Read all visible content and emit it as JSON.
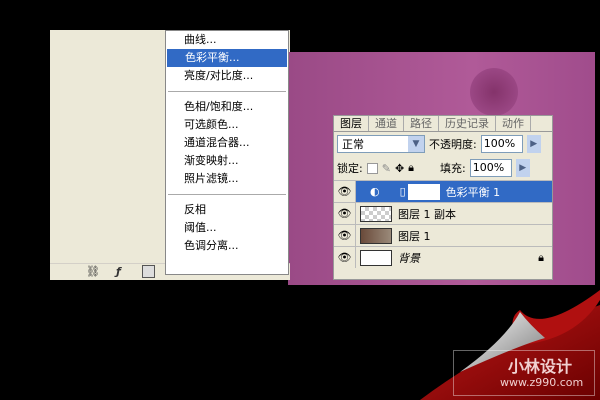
{
  "menu": {
    "items": [
      "曲线...",
      "色彩平衡...",
      "亮度/对比度...",
      "色相/饱和度...",
      "可选颜色...",
      "通道混合器...",
      "渐变映射...",
      "照片滤镜...",
      "反相",
      "阈值...",
      "色调分离..."
    ],
    "selected": "色彩平衡..."
  },
  "panel": {
    "tabs": [
      "图层",
      "通道",
      "路径",
      "历史记录",
      "动作"
    ],
    "blend_mode": "正常",
    "opacity_label": "不透明度:",
    "opacity": "100%",
    "lock_label": "锁定:",
    "fill_label": "填充:",
    "fill": "100%",
    "layers": [
      {
        "name": "色彩平衡 1"
      },
      {
        "name": "图层 1 副本"
      },
      {
        "name": "图层 1"
      },
      {
        "name": "背景"
      }
    ]
  },
  "watermark": {
    "title": "小林设计",
    "url": "www.z990.com"
  },
  "colors": {
    "accent": "#316ac5",
    "purple": "#a85292",
    "red": "#b01010"
  }
}
